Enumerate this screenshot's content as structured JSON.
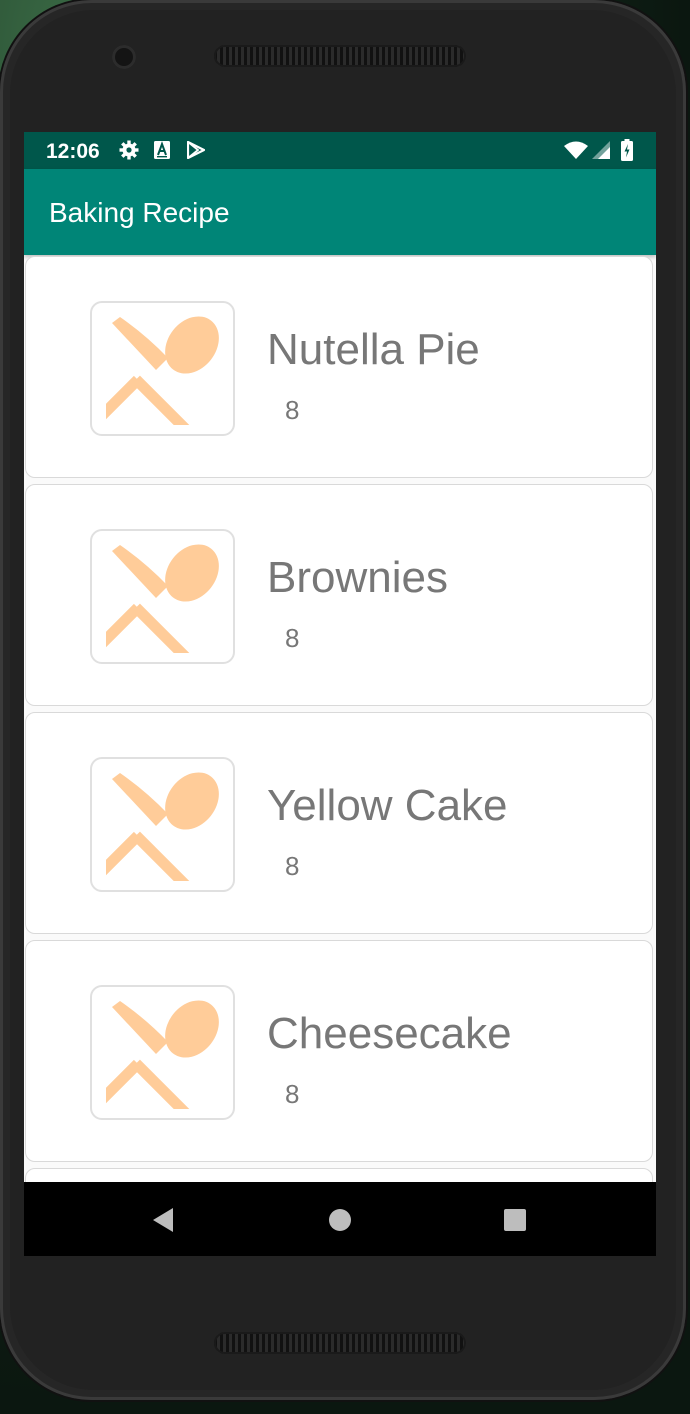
{
  "status_bar": {
    "time": "12:06",
    "icons_left": [
      "gear-icon",
      "a-keyboard-icon",
      "play-store-icon"
    ],
    "icons_right": [
      "wifi-icon",
      "signal-icon",
      "battery-charging-icon"
    ]
  },
  "app_bar": {
    "title": "Baking Recipe"
  },
  "recipes": [
    {
      "name": "Nutella Pie",
      "servings": "8",
      "icon": "utensils-icon"
    },
    {
      "name": "Brownies",
      "servings": "8",
      "icon": "utensils-icon"
    },
    {
      "name": "Yellow Cake",
      "servings": "8",
      "icon": "utensils-icon"
    },
    {
      "name": "Cheesecake",
      "servings": "8",
      "icon": "utensils-icon"
    }
  ],
  "nav_bar": {
    "buttons": [
      "back-icon",
      "home-icon",
      "recents-icon"
    ]
  },
  "colors": {
    "status_bar": "#00574b",
    "app_bar": "#008577",
    "icon_accent": "#ffcc99",
    "text_secondary": "#777777"
  }
}
